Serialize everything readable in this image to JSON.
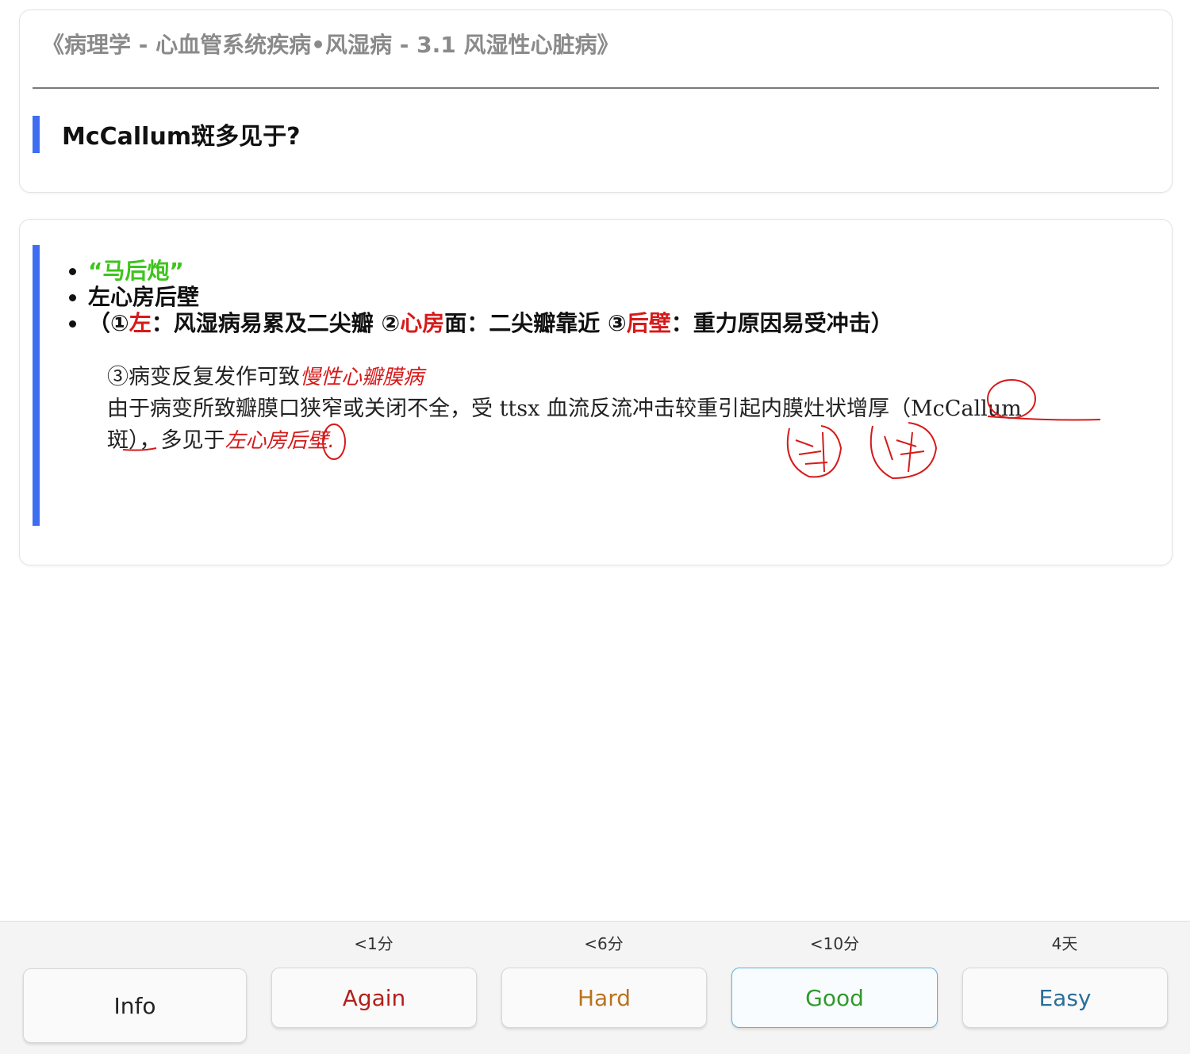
{
  "question_card": {
    "deck_title": "《病理学 - 心血管系统疾病•风湿病 - 3.1 风湿性心脏病》",
    "question": "McCallum斑多见于?"
  },
  "answer_card": {
    "item1": "“马后炮”",
    "item2": "左心房后壁",
    "item3": {
      "p1": "（①",
      "r1": "左",
      "p2": "：风湿病易累及二尖瓣 ②",
      "r2": "心房",
      "p3": "面：二尖瓣靠近 ③",
      "r3": "后壁",
      "p4": "：重力原因易受冲击）"
    },
    "note": {
      "line1": "③病变反复发作可致",
      "line1_handwriting": "慢性心瓣膜病",
      "line2": "由于病变所致瓣膜口狭窄或关闭不全，受 ttsx 血流反流冲击较重引起内膜灶状增厚（McCallum",
      "line3": "斑），多见于",
      "line3_handwriting": "左心房后壁."
    }
  },
  "footer": {
    "intervals": {
      "again": "<1分",
      "hard": "<6分",
      "good": "<10分",
      "easy": "4天"
    },
    "buttons": {
      "info": "Info",
      "again": "Again",
      "hard": "Hard",
      "good": "Good",
      "easy": "Easy"
    }
  },
  "colors": {
    "accent_bar": "#3d6ef2",
    "highlight_red": "#d61a1a",
    "highlight_green": "#3ec41d"
  }
}
